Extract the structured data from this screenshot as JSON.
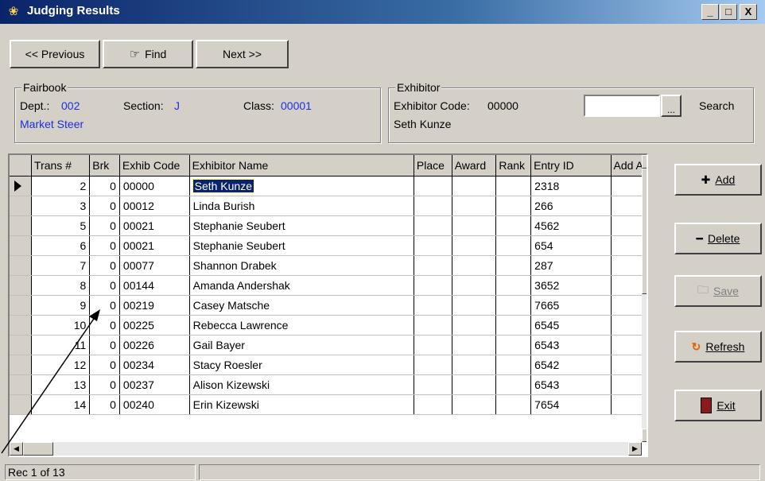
{
  "window": {
    "title": "Judging Results",
    "controls": [
      "_",
      "□",
      "X"
    ]
  },
  "toolbar": {
    "previous_label": "<< Previous",
    "find_label": "Find",
    "next_label": "Next >>"
  },
  "fairbook": {
    "legend": "Fairbook",
    "dept_label": "Dept.:",
    "dept_value": "002",
    "section_label": "Section:",
    "section_value": "J",
    "class_label": "Class:",
    "class_value": "00001",
    "class_name": "Market Steer"
  },
  "exhibitor": {
    "legend": "Exhibitor",
    "code_label": "Exhibitor Code:",
    "code_value": "00000",
    "name": "Seth Kunze",
    "search_input_value": "",
    "ellipsis_label": "...",
    "search_label": "Search"
  },
  "grid": {
    "columns": [
      "Trans #",
      "Brk",
      "Exhib Code",
      "Exhibitor Name",
      "Place",
      "Award",
      "Rank",
      "Entry ID",
      "Add A"
    ],
    "rows": [
      {
        "trans": "2",
        "brk": "0",
        "code": "00000",
        "name": "Seth Kunze",
        "entry": "2318"
      },
      {
        "trans": "3",
        "brk": "0",
        "code": "00012",
        "name": "Linda Burish",
        "entry": "266"
      },
      {
        "trans": "5",
        "brk": "0",
        "code": "00021",
        "name": "Stephanie Seubert",
        "entry": "4562"
      },
      {
        "trans": "6",
        "brk": "0",
        "code": "00021",
        "name": "Stephanie Seubert",
        "entry": "654"
      },
      {
        "trans": "7",
        "brk": "0",
        "code": "00077",
        "name": "Shannon Drabek",
        "entry": "287"
      },
      {
        "trans": "8",
        "brk": "0",
        "code": "00144",
        "name": "Amanda Andershak",
        "entry": "3652"
      },
      {
        "trans": "9",
        "brk": "0",
        "code": "00219",
        "name": "Casey Matsche",
        "entry": "7665"
      },
      {
        "trans": "10",
        "brk": "0",
        "code": "00225",
        "name": "Rebecca Lawrence",
        "entry": "6545"
      },
      {
        "trans": "11",
        "brk": "0",
        "code": "00226",
        "name": "Gail Bayer",
        "entry": "6543"
      },
      {
        "trans": "12",
        "brk": "0",
        "code": "00234",
        "name": "Stacy Roesler",
        "entry": "6542"
      },
      {
        "trans": "13",
        "brk": "0",
        "code": "00237",
        "name": "Alison Kizewski",
        "entry": "6543"
      },
      {
        "trans": "14",
        "brk": "0",
        "code": "00240",
        "name": "Erin Kizewski",
        "entry": "7654"
      }
    ]
  },
  "actions": {
    "add_label": "Add",
    "delete_label": "Delete",
    "save_label": "Save",
    "refresh_label": "Refresh",
    "exit_label": "Exit"
  },
  "status": {
    "record_text": "Rec 1 of 13"
  },
  "icons": {
    "title": "ribbon-icon",
    "find": "find-hand-icon",
    "add": "plus-icon",
    "delete": "minus-icon",
    "save": "folder-icon",
    "refresh": "refresh-icon",
    "exit": "door-icon"
  }
}
